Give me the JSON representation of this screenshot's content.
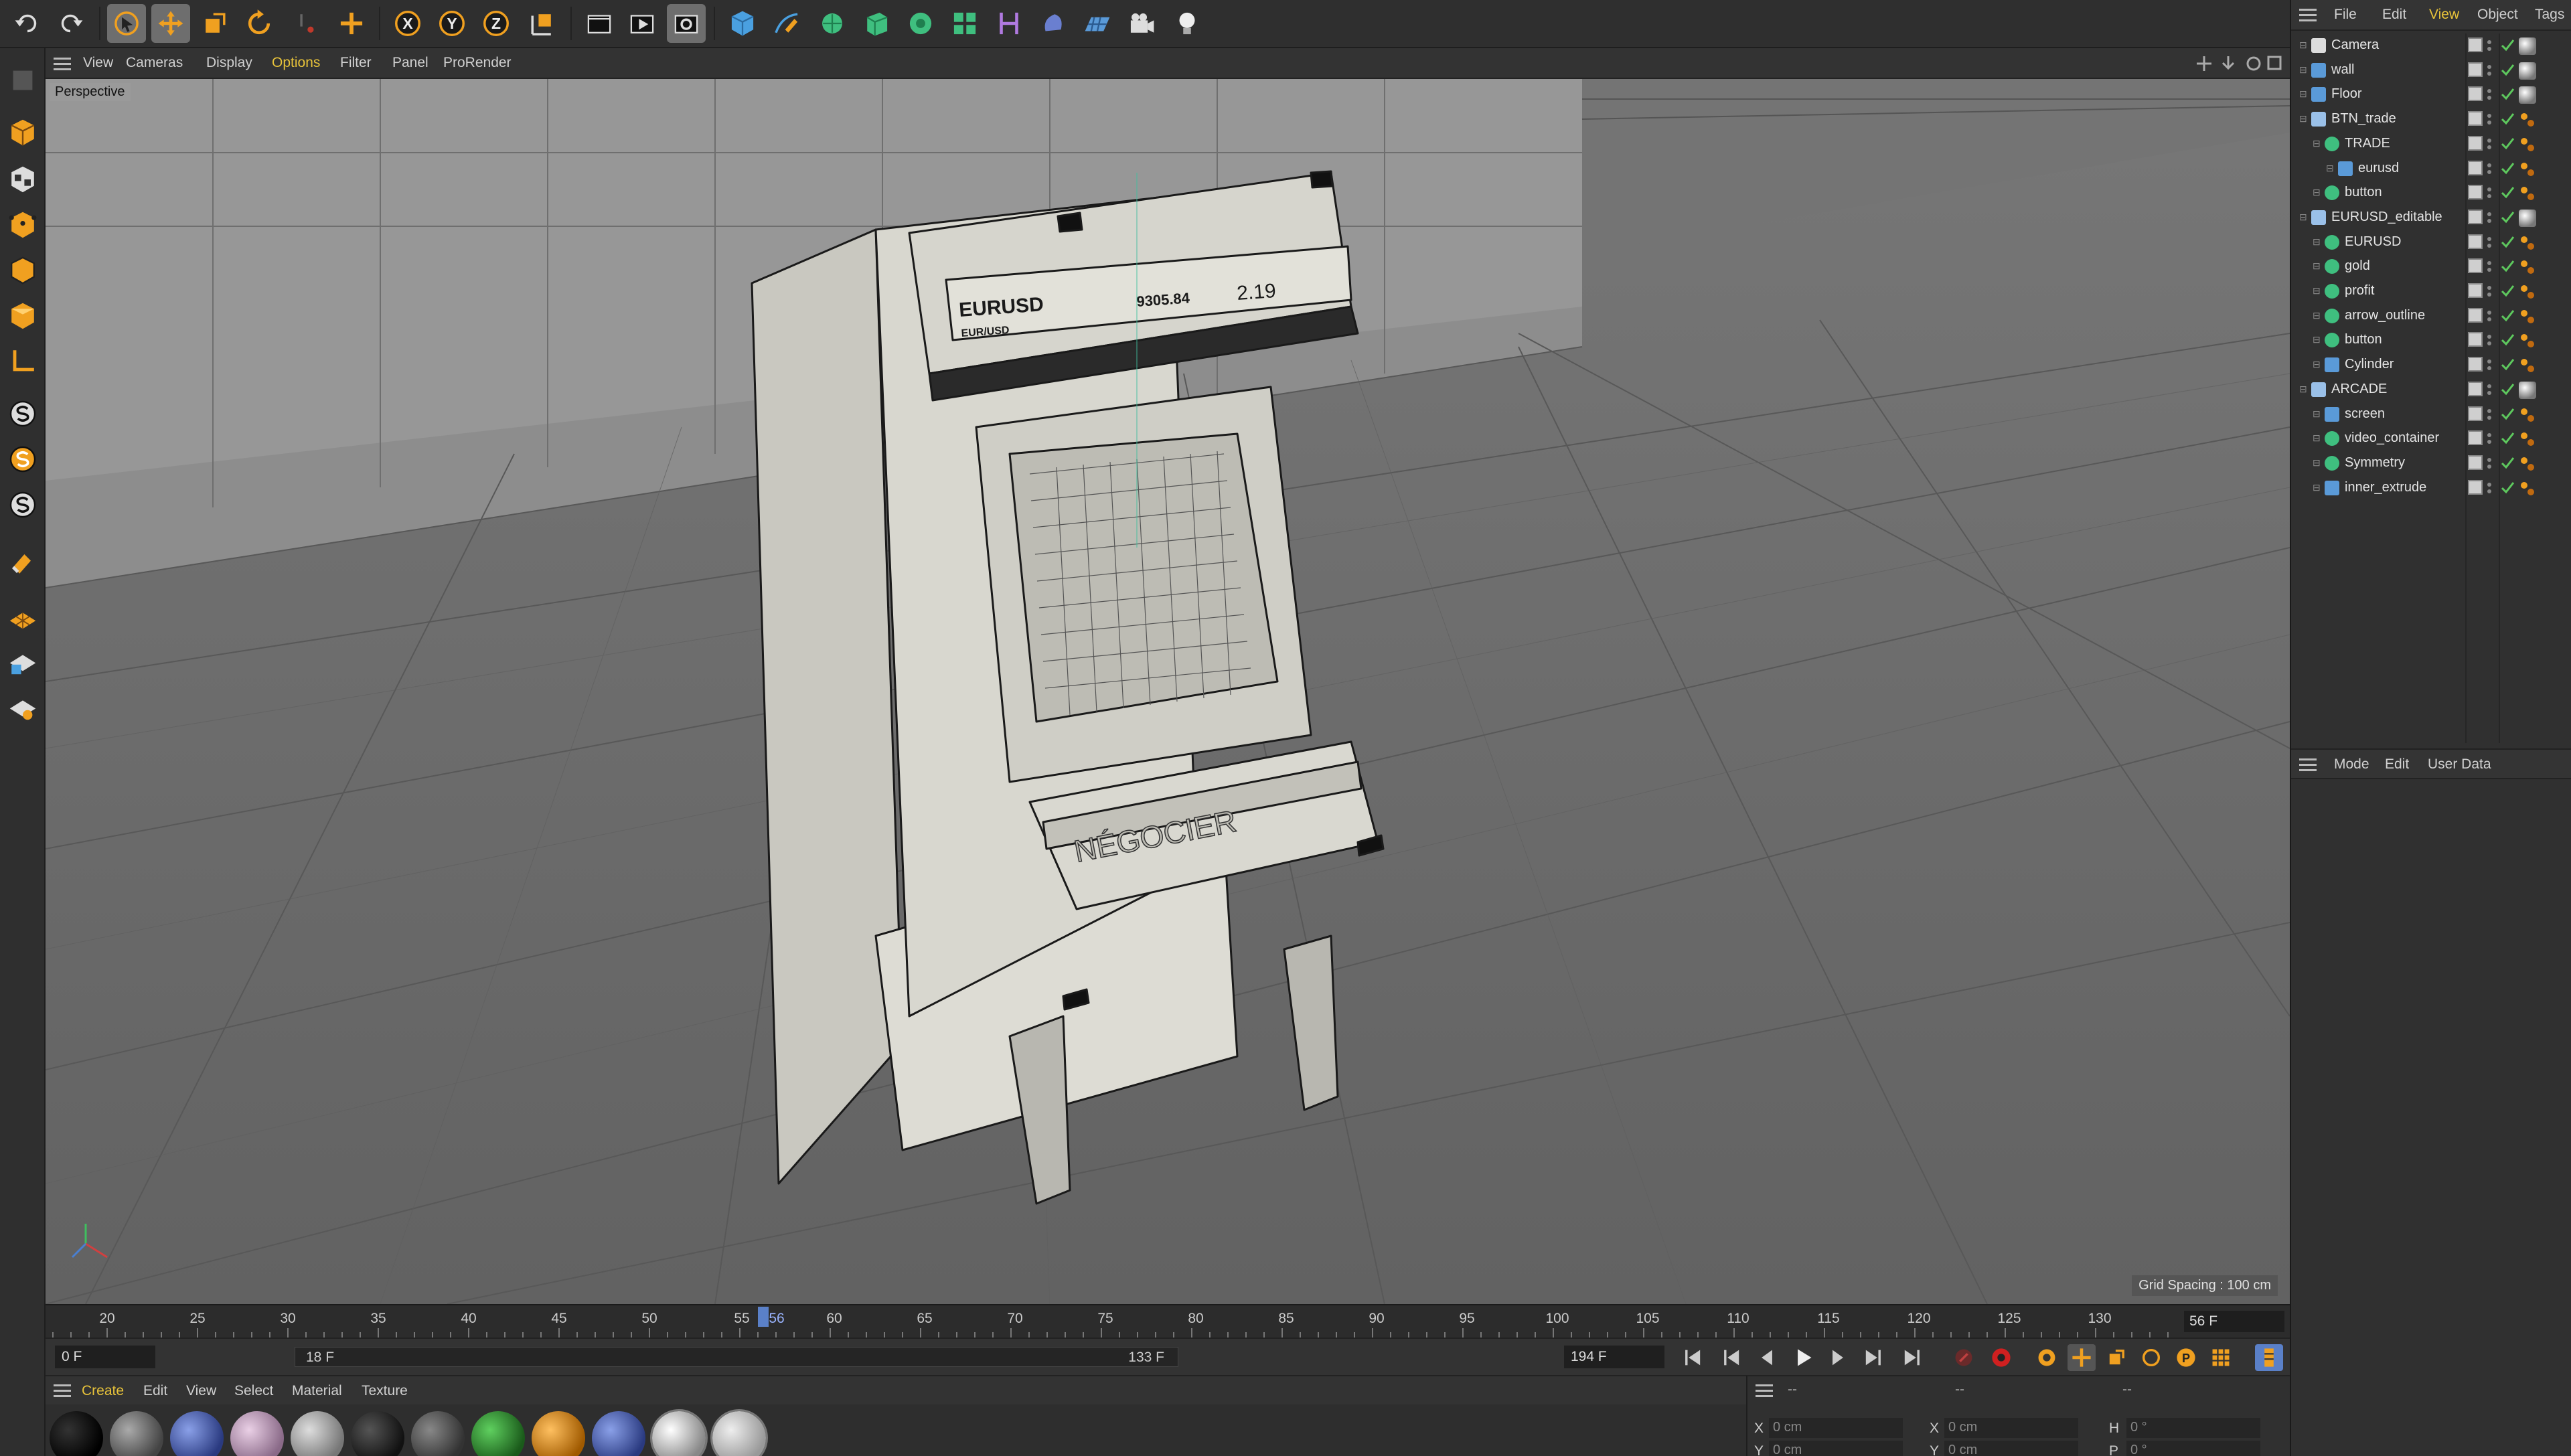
{
  "toolbar": {
    "tools": [
      "undo-icon",
      "redo-icon",
      "select-arrow-icon",
      "move-icon",
      "scale-icon",
      "rotate-icon",
      "live-select-icon",
      "add-icon",
      "x-axis-icon",
      "y-axis-icon",
      "z-axis-icon",
      "coordinate-system-icon",
      "render-region-icon",
      "render-view-icon",
      "render-settings-icon",
      "cube-icon",
      "pen-icon",
      "subdivision-icon",
      "extrude-icon",
      "cloner-icon",
      "array-icon",
      "deformer-icon",
      "material-icon",
      "floor-icon",
      "camera-icon",
      "light-icon"
    ],
    "axis_labels": {
      "x": "X",
      "y": "Y",
      "z": "Z"
    }
  },
  "viewport_menu": {
    "items": [
      "View",
      "Cameras",
      "Display",
      "Options",
      "Filter",
      "Panel",
      "ProRender"
    ],
    "highlighted": "Options"
  },
  "viewport": {
    "label": "Perspective",
    "grid_spacing": "Grid Spacing : 100 cm",
    "sign_top_title": "EURUSD",
    "sign_top_sub": "EUR/USD",
    "sign_top_price": "9305.84",
    "sign_top_change": "2.19",
    "panel_text": "NÉGOCIER"
  },
  "timeline": {
    "labels": [
      "20",
      "25",
      "30",
      "35",
      "40",
      "45",
      "50",
      "55",
      "60",
      "65",
      "70",
      "75",
      "80",
      "85",
      "90",
      "95",
      "100",
      "105",
      "110",
      "115",
      "120",
      "125",
      "130"
    ],
    "current_marker": "56",
    "current_frame": "56 F"
  },
  "transport": {
    "start_frame": "0 F",
    "range_start": "18 F",
    "range_end": "133 F",
    "end_frame": "194 F"
  },
  "material_menu": {
    "items": [
      "Create",
      "Edit",
      "View",
      "Select",
      "Material",
      "Texture"
    ],
    "highlighted": "Create",
    "swatches": [
      "#111111",
      "#6a6a6a",
      "#4a5fa8",
      "#c4a6c0",
      "#a8a8a8",
      "#2a2a2a",
      "#5a5a5a",
      "#2f8a2f",
      "#e08a1e",
      "#4a5fa8",
      "#e8e8e8",
      "#c8c8c8"
    ]
  },
  "coords": {
    "headers": [
      "--",
      "--",
      "--"
    ],
    "rows": [
      {
        "a1": "X",
        "v1": "0 cm",
        "a2": "X",
        "v2": "0 cm",
        "a3": "H",
        "v3": "0 °"
      },
      {
        "a1": "Y",
        "v1": "0 cm",
        "a2": "Y",
        "v2": "0 cm",
        "a3": "P",
        "v3": "0 °"
      }
    ]
  },
  "object_manager": {
    "menu": [
      "File",
      "Edit",
      "View",
      "Object",
      "Tags"
    ],
    "highlighted": "View",
    "objects": [
      {
        "name": "Camera",
        "depth": 0,
        "icon": "camera-icon"
      },
      {
        "name": "wall",
        "depth": 0,
        "icon": "plane-icon"
      },
      {
        "name": "Floor",
        "depth": 0,
        "icon": "floor-icon"
      },
      {
        "name": "BTN_trade",
        "depth": 0,
        "icon": "null-icon"
      },
      {
        "name": "TRADE",
        "depth": 1,
        "icon": "extrude-icon"
      },
      {
        "name": "eurusd",
        "depth": 2,
        "icon": "text-icon"
      },
      {
        "name": "button",
        "depth": 1,
        "icon": "extrude-icon"
      },
      {
        "name": "EURUSD_editable",
        "depth": 0,
        "icon": "null-icon"
      },
      {
        "name": "EURUSD",
        "depth": 1,
        "icon": "extrude-icon"
      },
      {
        "name": "gold",
        "depth": 1,
        "icon": "extrude-icon"
      },
      {
        "name": "profit",
        "depth": 1,
        "icon": "extrude-icon"
      },
      {
        "name": "arrow_outline",
        "depth": 1,
        "icon": "extrude-icon"
      },
      {
        "name": "button",
        "depth": 1,
        "icon": "extrude-icon"
      },
      {
        "name": "Cylinder",
        "depth": 1,
        "icon": "cylinder-icon"
      },
      {
        "name": "ARCADE",
        "depth": 0,
        "icon": "null-icon"
      },
      {
        "name": "screen",
        "depth": 1,
        "icon": "polygon-icon"
      },
      {
        "name": "video_container",
        "depth": 1,
        "icon": "extrude-icon"
      },
      {
        "name": "Symmetry",
        "depth": 1,
        "icon": "symmetry-icon"
      },
      {
        "name": "inner_extrude",
        "depth": 1,
        "icon": "polygon-icon"
      }
    ]
  },
  "attributes": {
    "menu": [
      "Mode",
      "Edit",
      "User Data"
    ]
  },
  "colors": {
    "accent": "#e8c33a",
    "active_tool": "#6e6e6e",
    "check_green": "#5ec95e",
    "object_icon_green": "#3fbf7f",
    "object_icon_blue": "#5a9ad8"
  }
}
